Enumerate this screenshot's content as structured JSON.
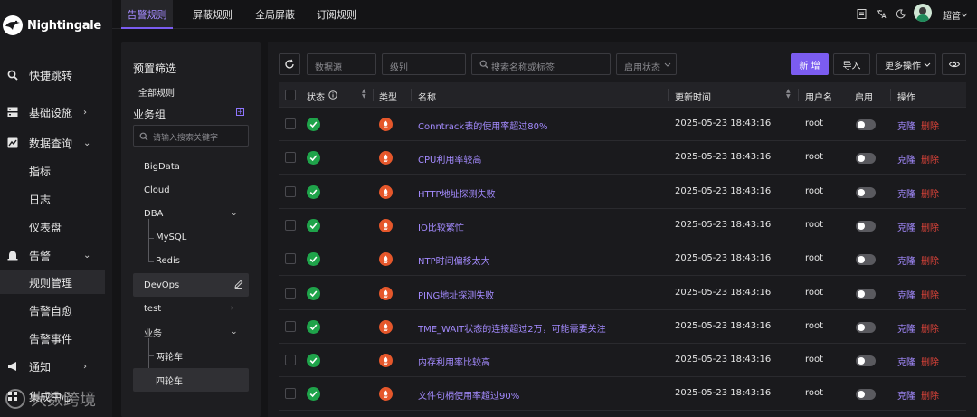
{
  "brand": {
    "name": "Nightingale"
  },
  "sidebar": {
    "items": [
      {
        "label": "快捷跳转",
        "icon": "search-icon",
        "chevron": ""
      },
      {
        "label": "基础设施",
        "icon": "server-icon",
        "chevron": "›"
      },
      {
        "label": "数据查询",
        "icon": "chart-icon",
        "chevron": "⌄"
      },
      {
        "label": "指标",
        "icon": "",
        "chevron": ""
      },
      {
        "label": "日志",
        "icon": "",
        "chevron": ""
      },
      {
        "label": "仪表盘",
        "icon": "",
        "chevron": ""
      },
      {
        "label": "告警",
        "icon": "alarm-icon",
        "chevron": "⌄"
      },
      {
        "label": "规则管理",
        "icon": "",
        "chevron": ""
      },
      {
        "label": "告警自愈",
        "icon": "",
        "chevron": ""
      },
      {
        "label": "告警事件",
        "icon": "",
        "chevron": ""
      },
      {
        "label": "通知",
        "icon": "megaphone-icon",
        "chevron": "›"
      },
      {
        "label": "集成中心",
        "icon": "integration-icon",
        "chevron": ""
      }
    ]
  },
  "tabs": [
    {
      "label": "告警规则"
    },
    {
      "label": "屏蔽规则"
    },
    {
      "label": "全局屏蔽"
    },
    {
      "label": "订阅规则"
    }
  ],
  "header": {
    "user": "超管"
  },
  "filter": {
    "title": "预置筛选",
    "all_rules": "全部规则",
    "group_title": "业务组",
    "add_symbol": "+",
    "search_placeholder": "请输入搜索关键字",
    "groups": [
      {
        "label": "BigData",
        "chevron": ""
      },
      {
        "label": "Cloud",
        "chevron": ""
      },
      {
        "label": "DBA",
        "chevron": "⌄"
      },
      {
        "label": "MySQL",
        "chevron": ""
      },
      {
        "label": "Redis",
        "chevron": ""
      },
      {
        "label": "DevOps",
        "chevron": ""
      },
      {
        "label": "test",
        "chevron": "›"
      },
      {
        "label": "业务",
        "chevron": "⌄"
      },
      {
        "label": "两轮车",
        "chevron": ""
      },
      {
        "label": "四轮车",
        "chevron": ""
      }
    ]
  },
  "toolbar": {
    "datasource_placeholder": "数据源",
    "level_placeholder": "级别",
    "search_placeholder": "搜索名称或标签",
    "enabled_status": "启用状态",
    "new_label": "新 增",
    "import_label": "导入",
    "more_label": "更多操作"
  },
  "table": {
    "headers": {
      "status": "状态",
      "type": "类型",
      "name": "名称",
      "updated": "更新时间",
      "user": "用户名",
      "enabled": "启用",
      "actions": "操作"
    },
    "clone_label": "克隆",
    "delete_label": "删除",
    "rows": [
      {
        "name": "Conntrack表的使用率超过80%",
        "updated": "2025-05-23 18:43:16",
        "user": "root"
      },
      {
        "name": "CPU利用率较高",
        "updated": "2025-05-23 18:43:16",
        "user": "root"
      },
      {
        "name": "HTTP地址探测失败",
        "updated": "2025-05-23 18:43:16",
        "user": "root"
      },
      {
        "name": "IO比较繁忙",
        "updated": "2025-05-23 18:43:16",
        "user": "root"
      },
      {
        "name": "NTP时间偏移太大",
        "updated": "2025-05-23 18:43:16",
        "user": "root"
      },
      {
        "name": "PING地址探测失败",
        "updated": "2025-05-23 18:43:16",
        "user": "root"
      },
      {
        "name": "TME_WAIT状态的连接超过2万，可能需要关注",
        "updated": "2025-05-23 18:43:16",
        "user": "root"
      },
      {
        "name": "内存利用率比较高",
        "updated": "2025-05-23 18:43:16",
        "user": "root"
      },
      {
        "name": "文件句柄使用率超过90%",
        "updated": "2025-05-23 18:43:16",
        "user": "root"
      }
    ]
  },
  "watermark": {
    "text": "大数跨境"
  },
  "colors": {
    "accent": "#7b5cf0",
    "link": "#a48bff",
    "danger": "#e0443a",
    "ok": "#1fa34a",
    "type": "#e5572b"
  }
}
